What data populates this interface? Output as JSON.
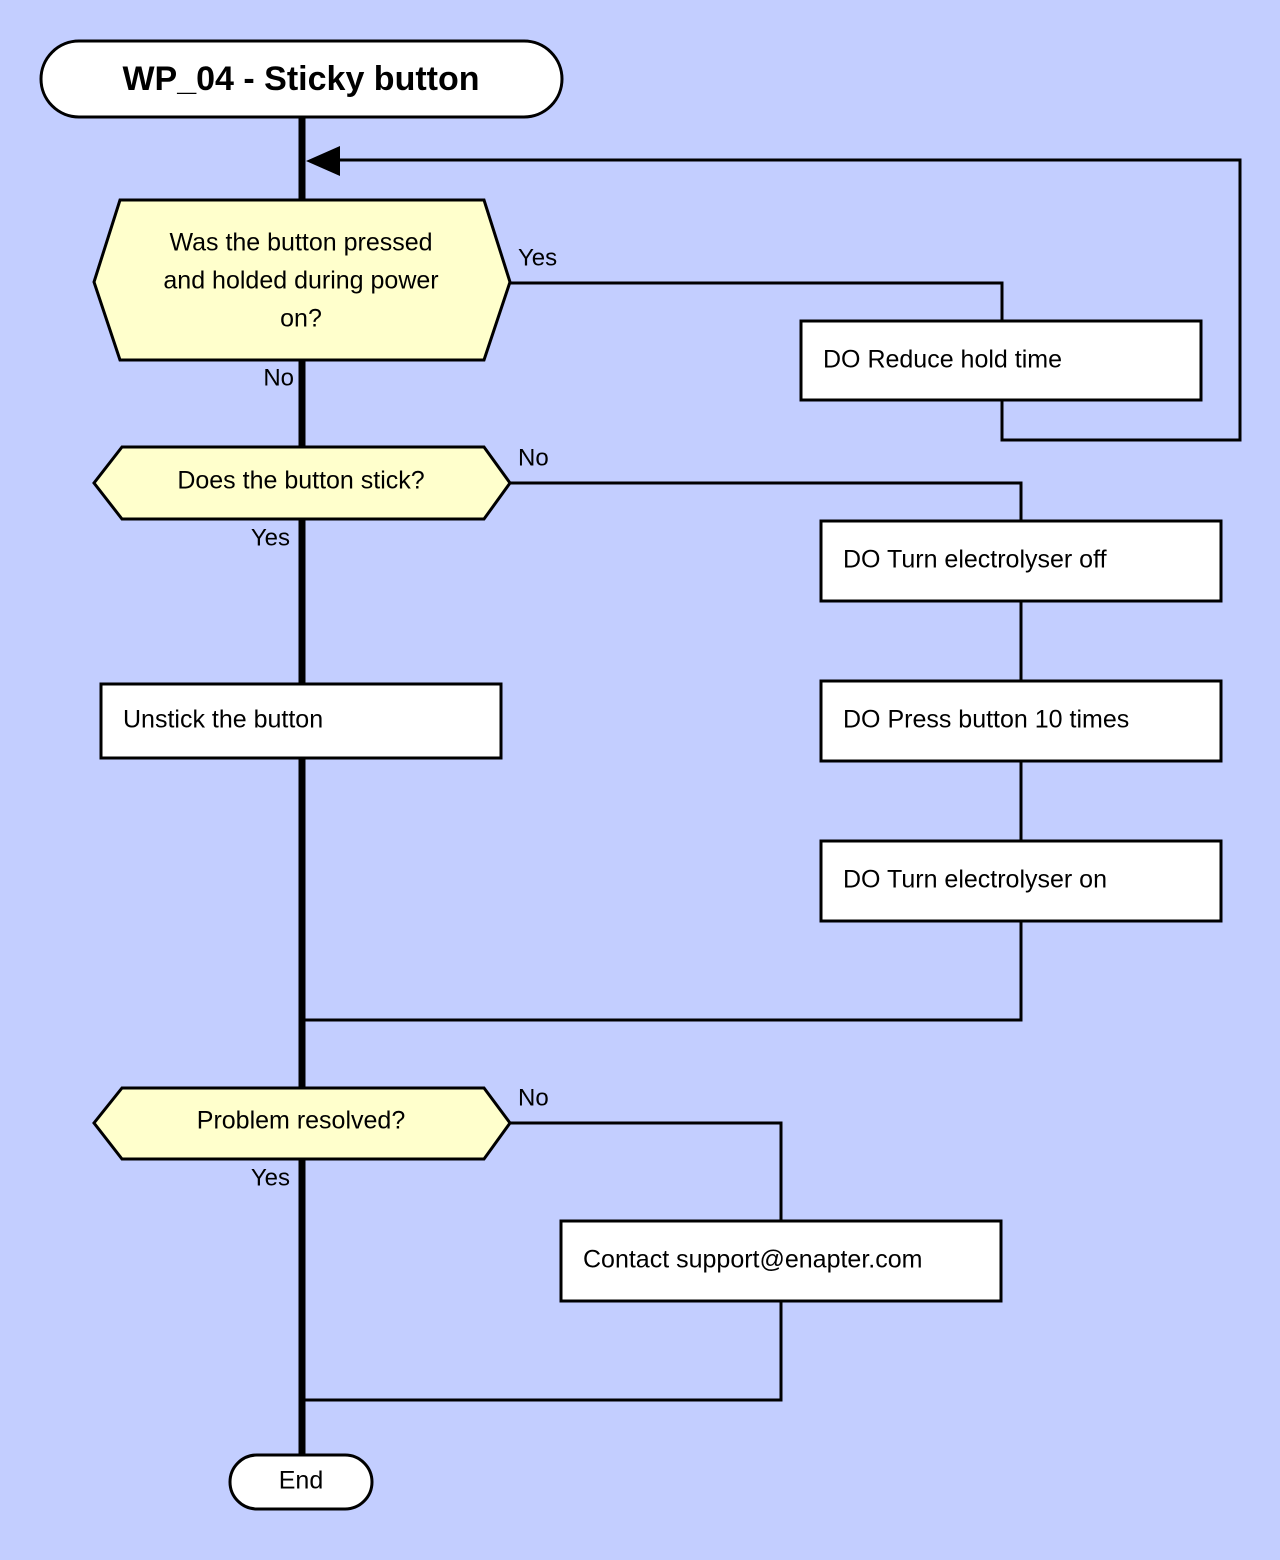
{
  "diagram": {
    "title": "WP_04 - Sticky button",
    "background_color": "#c3ceff",
    "decision_fill": "#ffffcc",
    "node_fill": "#ffffff",
    "stroke_color": "#000000",
    "end_label": "End"
  },
  "nodes": {
    "start": {
      "label": "WP_04 - Sticky button",
      "type": "terminal"
    },
    "d1": {
      "label_line1": "Was the button pressed",
      "label_line2": "and holded during power",
      "label_line3": "on?",
      "type": "decision"
    },
    "a1": {
      "label": "DO Reduce hold time",
      "type": "action"
    },
    "d2": {
      "label": "Does the button stick?",
      "type": "decision"
    },
    "a2": {
      "label": "DO Turn electrolyser off",
      "type": "action"
    },
    "a3": {
      "label": "DO Press button 10 times",
      "type": "action"
    },
    "a4": {
      "label": "DO Turn electrolyser on",
      "type": "action"
    },
    "a5": {
      "label": "Unstick the button",
      "type": "action"
    },
    "d3": {
      "label": "Problem resolved?",
      "type": "decision"
    },
    "a6": {
      "label": "Contact support@enapter.com",
      "type": "action"
    },
    "end": {
      "label": "End",
      "type": "terminal"
    }
  },
  "edges": {
    "d1_yes": "Yes",
    "d1_no": "No",
    "d2_no": "No",
    "d2_yes": "Yes",
    "d3_no": "No",
    "d3_yes": "Yes"
  },
  "chart_data": {
    "type": "diagram",
    "subtype": "flowchart",
    "title": "WP_04 - Sticky button",
    "nodes": [
      {
        "id": "start",
        "shape": "stadium",
        "text": "WP_04 - Sticky button"
      },
      {
        "id": "d1",
        "shape": "hexagon",
        "text": "Was the button pressed and holded during power on?"
      },
      {
        "id": "a1",
        "shape": "rect",
        "text": "DO Reduce hold time"
      },
      {
        "id": "d2",
        "shape": "hexagon",
        "text": "Does the button stick?"
      },
      {
        "id": "a2",
        "shape": "rect",
        "text": "DO Turn electrolyser off"
      },
      {
        "id": "a3",
        "shape": "rect",
        "text": "DO Press button 10 times"
      },
      {
        "id": "a4",
        "shape": "rect",
        "text": "DO Turn electrolyser on"
      },
      {
        "id": "a5",
        "shape": "rect",
        "text": "Unstick the button"
      },
      {
        "id": "d3",
        "shape": "hexagon",
        "text": "Problem resolved?"
      },
      {
        "id": "a6",
        "shape": "rect",
        "text": "Contact support@enapter.com"
      },
      {
        "id": "end",
        "shape": "stadium",
        "text": "End"
      }
    ],
    "links": [
      {
        "from": "start",
        "to": "d1",
        "label": ""
      },
      {
        "from": "d1",
        "to": "a1",
        "label": "Yes"
      },
      {
        "from": "a1",
        "to": "d1",
        "label": ""
      },
      {
        "from": "d1",
        "to": "d2",
        "label": "No"
      },
      {
        "from": "d2",
        "to": "a2",
        "label": "No"
      },
      {
        "from": "a2",
        "to": "a3",
        "label": ""
      },
      {
        "from": "a3",
        "to": "a4",
        "label": ""
      },
      {
        "from": "a4",
        "to": "d3",
        "label": ""
      },
      {
        "from": "d2",
        "to": "a5",
        "label": "Yes"
      },
      {
        "from": "a5",
        "to": "d3",
        "label": ""
      },
      {
        "from": "d3",
        "to": "a6",
        "label": "No"
      },
      {
        "from": "a6",
        "to": "end",
        "label": ""
      },
      {
        "from": "d3",
        "to": "end",
        "label": "Yes"
      }
    ]
  }
}
